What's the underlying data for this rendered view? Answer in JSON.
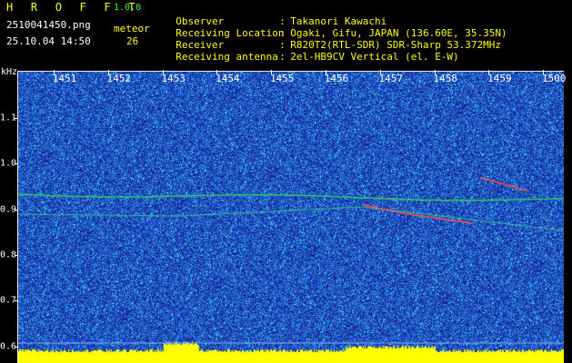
{
  "header": {
    "app_title": "H R O F F T",
    "app_version": "1.0.0",
    "file_name": "2510041450.png",
    "meteor_label": "meteor",
    "datetime": "25.10.04 14:50",
    "meteor_count": "26"
  },
  "info": [
    {
      "key": "Observer",
      "value": "Takanori Kawachi"
    },
    {
      "key": "Receiving Location",
      "value": "Ogaki, Gifu, JAPAN (136.60E, 35.35N)"
    },
    {
      "key": "Receiver",
      "value": "R820T2(RTL-SDR) SDR-Sharp 53.372MHz"
    },
    {
      "key": "Receiving antenna",
      "value": "2el-HB9CV Vertical (el. E-W)"
    }
  ],
  "axes": {
    "unit": "kHz",
    "time_labels": [
      "1451",
      "1452",
      "1453",
      "1454",
      "1455",
      "1456",
      "1457",
      "1458",
      "1459",
      "1500"
    ],
    "freq_labels": [
      "1.1",
      "1.0",
      "0.9",
      "0.8",
      "0.7",
      "0.6"
    ]
  },
  "colors": {
    "background": "#000000",
    "title": "#ffff00",
    "info_text": "#33ff33",
    "spectrogram_base": "#1e36a8",
    "noise": "#2a8af0",
    "bright_noise": "#40e0e0",
    "carrier_line": "#33cc66",
    "meteor_trail": "#ff5050",
    "bottom_bar": "#ffff00"
  }
}
